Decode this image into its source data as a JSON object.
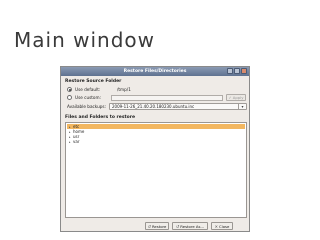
{
  "slide": {
    "title": "Main window"
  },
  "window": {
    "title": "Restore Files/Directories"
  },
  "restore_source": {
    "header": "Restore Source Folder",
    "use_default_label": "Use default:",
    "default_value": "/tmp/1",
    "use_custom_label": "Use custom:",
    "custom_value": "",
    "apply_label": "Apply",
    "selected": "default"
  },
  "backups": {
    "label": "Available backups:",
    "selected": "2009-11-26_21.40.20.180230.ubuntu.inc"
  },
  "files": {
    "header": "Files and Folders to restore",
    "items": [
      {
        "name": "etc",
        "selected": true
      },
      {
        "name": "home",
        "selected": false
      },
      {
        "name": "usr",
        "selected": false
      },
      {
        "name": "var",
        "selected": false
      }
    ]
  },
  "buttons": {
    "restore": "Restore",
    "restore_as": "Restore As...",
    "close": "Close"
  }
}
